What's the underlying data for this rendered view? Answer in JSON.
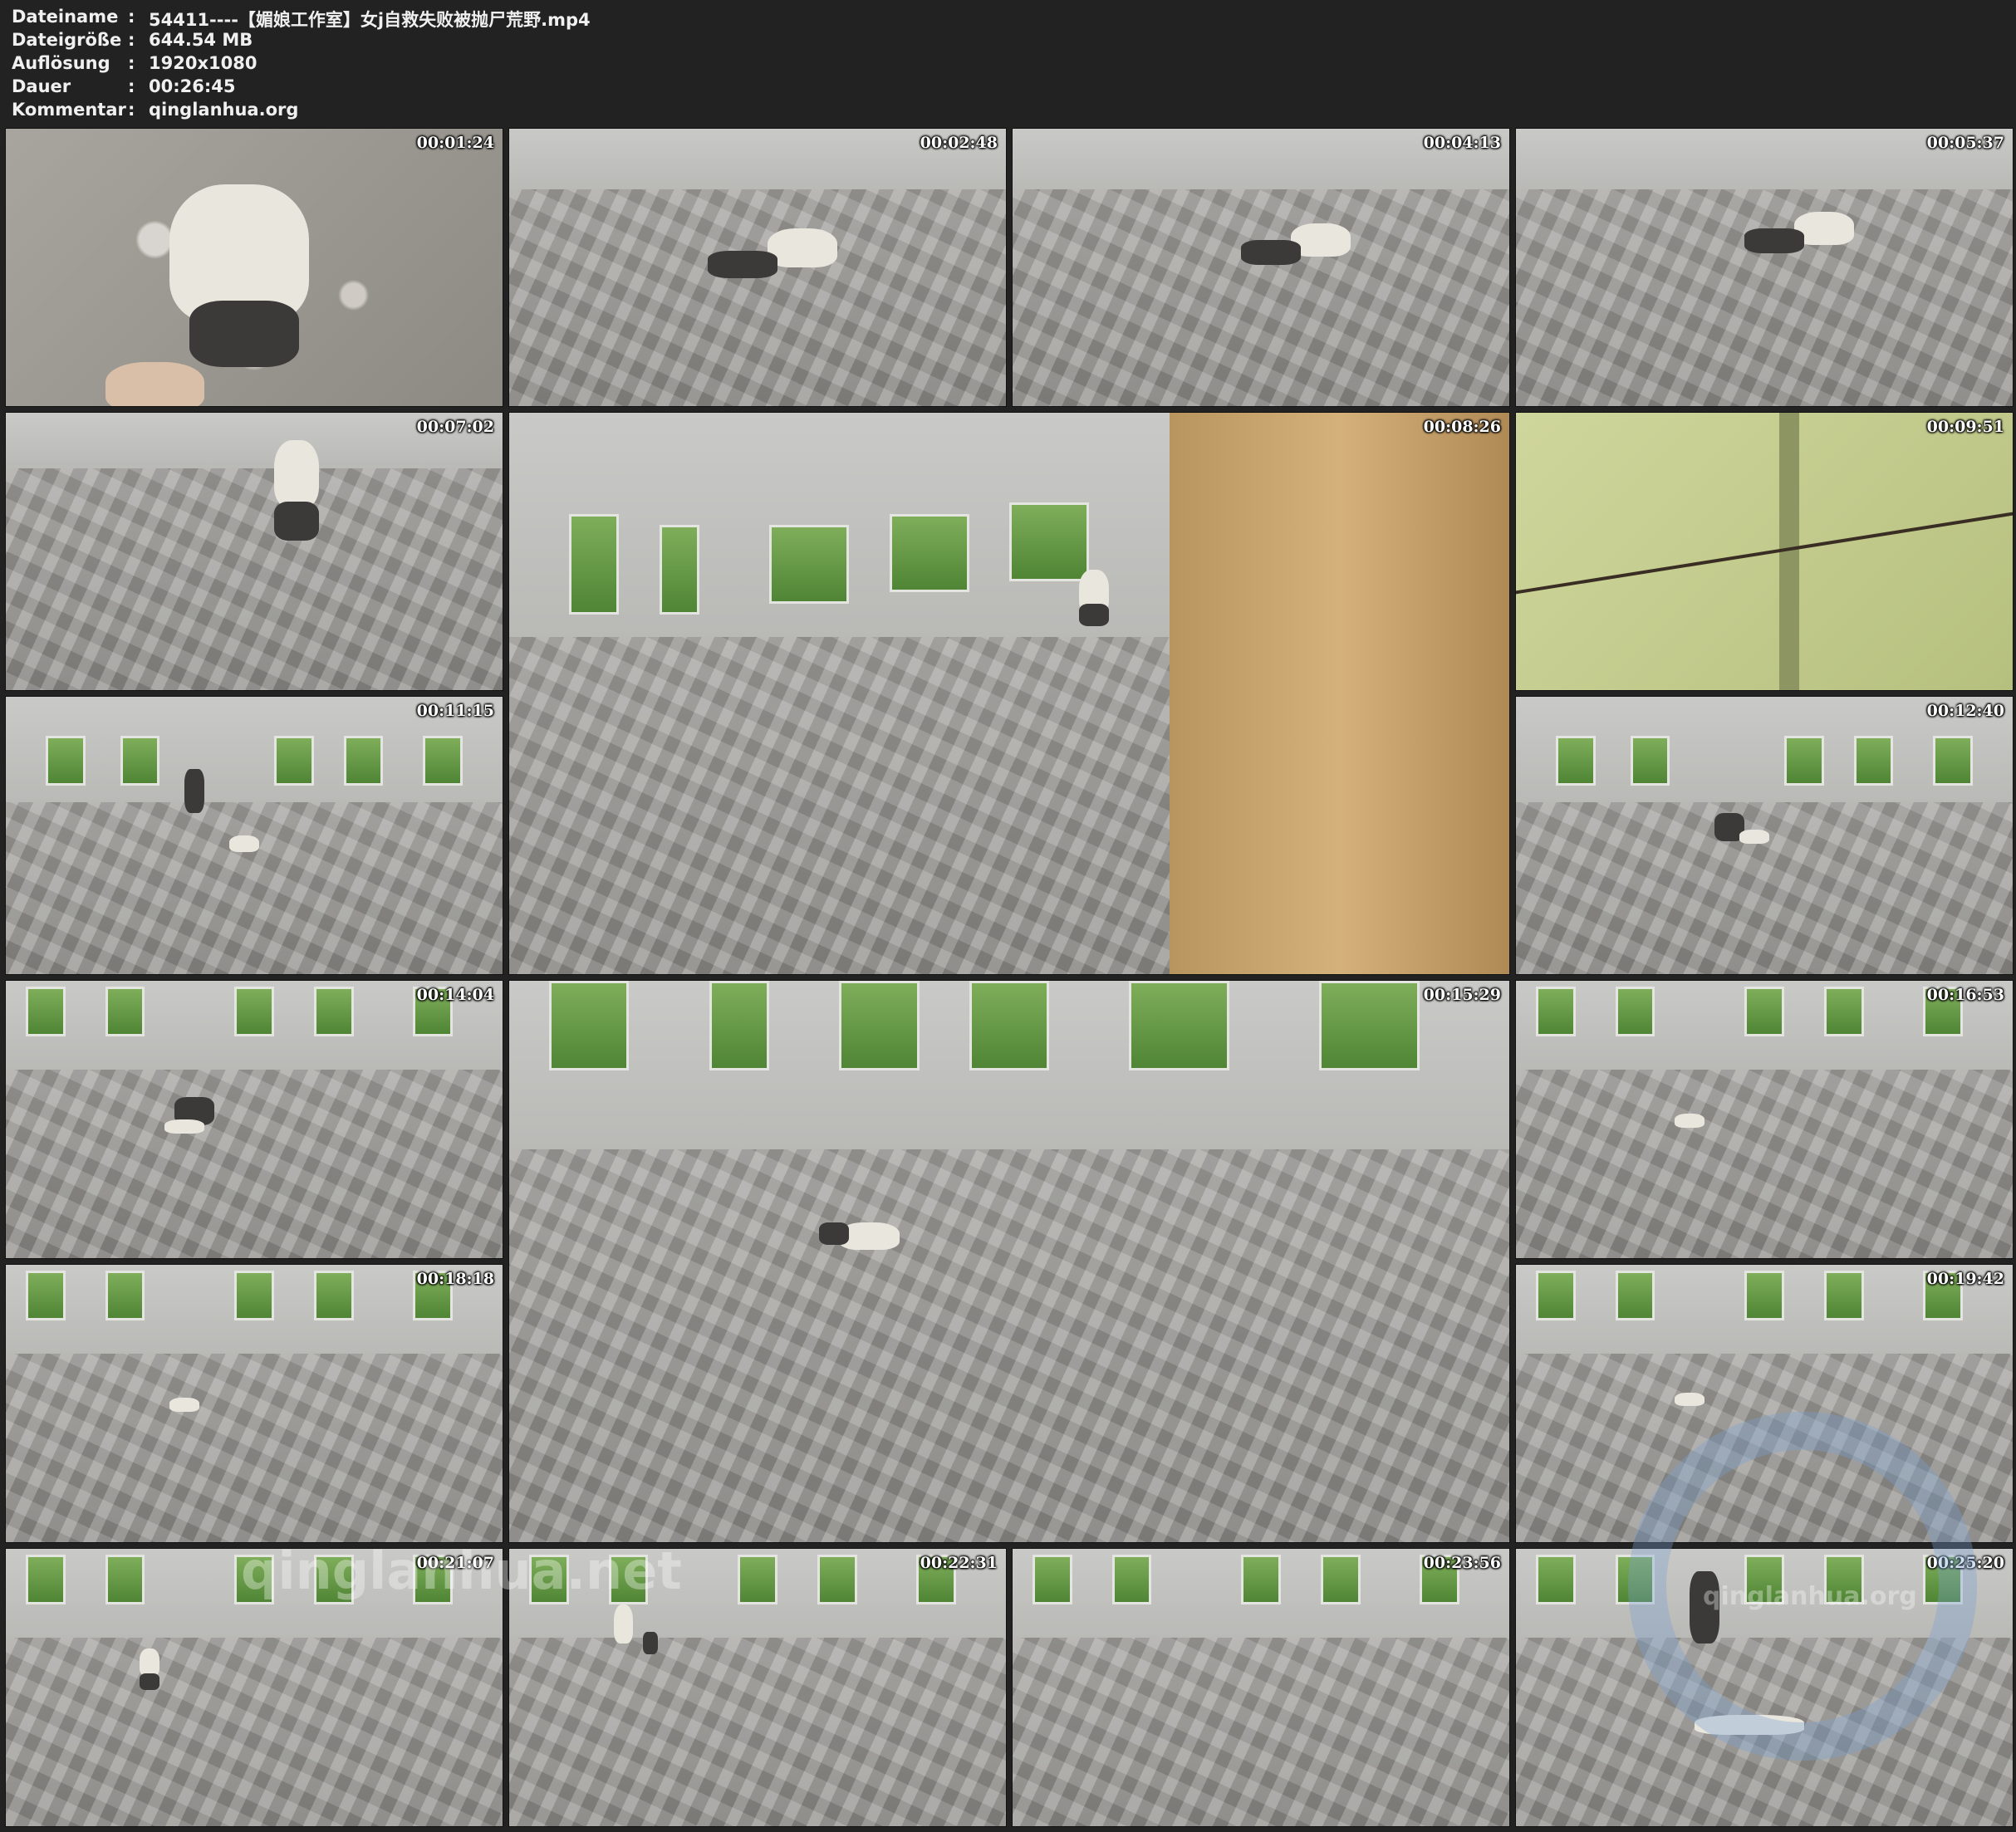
{
  "info": {
    "rows": [
      {
        "key": "Dateiname",
        "value": "54411----【媚娘工作室】女j自救失败被抛尸荒野.mp4"
      },
      {
        "key": "Dateigröße",
        "value": "644.54 MB"
      },
      {
        "key": "Auflösung",
        "value": "1920x1080"
      },
      {
        "key": "Dauer",
        "value": "00:26:45"
      },
      {
        "key": "Kommentar",
        "value": "qinglanhua.org"
      }
    ],
    "separator": ":"
  },
  "thumbnails": [
    {
      "time": "00:01:24"
    },
    {
      "time": "00:02:48"
    },
    {
      "time": "00:04:13"
    },
    {
      "time": "00:05:37"
    },
    {
      "time": "00:07:02"
    },
    {
      "time": "00:08:26"
    },
    {
      "time": "00:09:51"
    },
    {
      "time": "00:11:15"
    },
    {
      "time": "00:12:40"
    },
    {
      "time": "00:14:04"
    },
    {
      "time": "00:15:29"
    },
    {
      "time": "00:16:53"
    },
    {
      "time": "00:18:18"
    },
    {
      "time": "00:19:42"
    },
    {
      "time": "00:21:07"
    },
    {
      "time": "00:22:31"
    },
    {
      "time": "00:23:56"
    },
    {
      "time": "00:25:20"
    }
  ],
  "watermarks": {
    "left": "qinglanhua.net",
    "right": "qinglanhua.org"
  }
}
